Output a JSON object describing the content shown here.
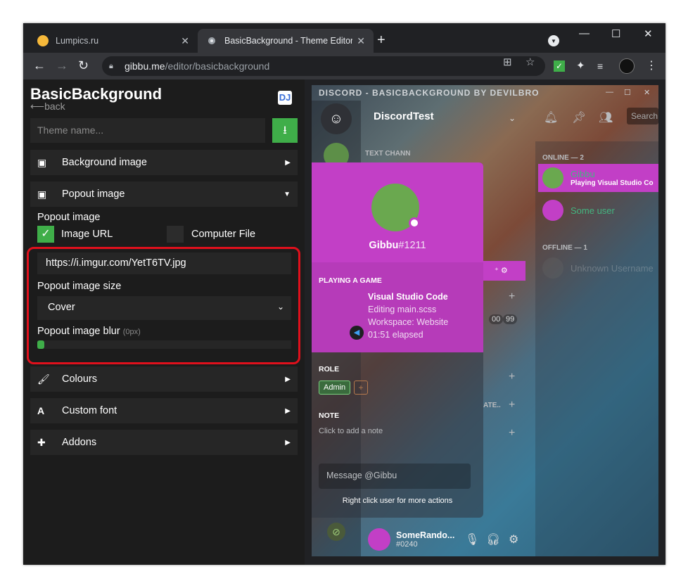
{
  "browser": {
    "tabs": [
      {
        "title": "Lumpics.ru",
        "close": "✕"
      },
      {
        "title": "BasicBackground - Theme Editor",
        "close": "✕"
      }
    ],
    "new_tab": "+",
    "url_host": "gibbu.me",
    "url_path": "/editor/basicbackground",
    "window_controls": [
      "—",
      "☐",
      "✕"
    ]
  },
  "editor": {
    "title": "BasicBackground",
    "back": "⟵back",
    "logo": "DJ",
    "theme_name_placeholder": "Theme name...",
    "sections": [
      {
        "label": "Background image",
        "icon": "image-icon",
        "expanded": false
      },
      {
        "label": "Popout image",
        "icon": "image-icon",
        "expanded": true
      },
      {
        "label": "Colours",
        "icon": "paint-roller-icon",
        "expanded": false
      },
      {
        "label": "Custom font",
        "icon": "font-icon",
        "expanded": false
      },
      {
        "label": "Addons",
        "icon": "puzzle-icon",
        "expanded": false
      }
    ],
    "popout": {
      "heading": "Popout image",
      "option_url": "Image URL",
      "option_file": "Computer File",
      "url_checked": true,
      "file_checked": false,
      "url_value": "https://i.imgur.com/YetT6TV.jpg",
      "size_label": "Popout image size",
      "size_value": "Cover",
      "blur_label": "Popout image blur",
      "blur_value": "(0px)",
      "blur_level": 0
    }
  },
  "discord": {
    "window_title": "DISCORD - BASICBACKGROUND BY DEVILBRO",
    "server_name": "DiscordTest",
    "text_channels": "TEXT CHANN",
    "search": "Search",
    "online_header": "ONLINE — 2",
    "offline_header": "OFFLINE — 1",
    "members": [
      {
        "name": "Gibbu",
        "activity": "Playing Visual Studio Co",
        "color": "#43b581"
      },
      {
        "name": "Some user",
        "activity": "",
        "color": "#43b581"
      }
    ],
    "offline_member": "Unknown Username",
    "popout": {
      "username": "Gibbu",
      "discriminator": "#1211",
      "playing_header": "PLAYING A GAME",
      "game": "Visual Studio Code",
      "game_lines": [
        "Editing main.scss",
        "Workspace: Website",
        "01:51 elapsed"
      ],
      "role_header": "ROLE",
      "role": "Admin",
      "role_add": "+",
      "note_header": "NOTE",
      "note_placeholder": "Click to add a note",
      "message_placeholder": "Message @Gibbu",
      "footer": "Right click user for more actions"
    },
    "channel_counts": [
      "00",
      "99"
    ],
    "channel_frag": "ATE..",
    "user": {
      "name": "SomeRando...",
      "tag": "#0240"
    },
    "accent": "#c23fc6"
  }
}
